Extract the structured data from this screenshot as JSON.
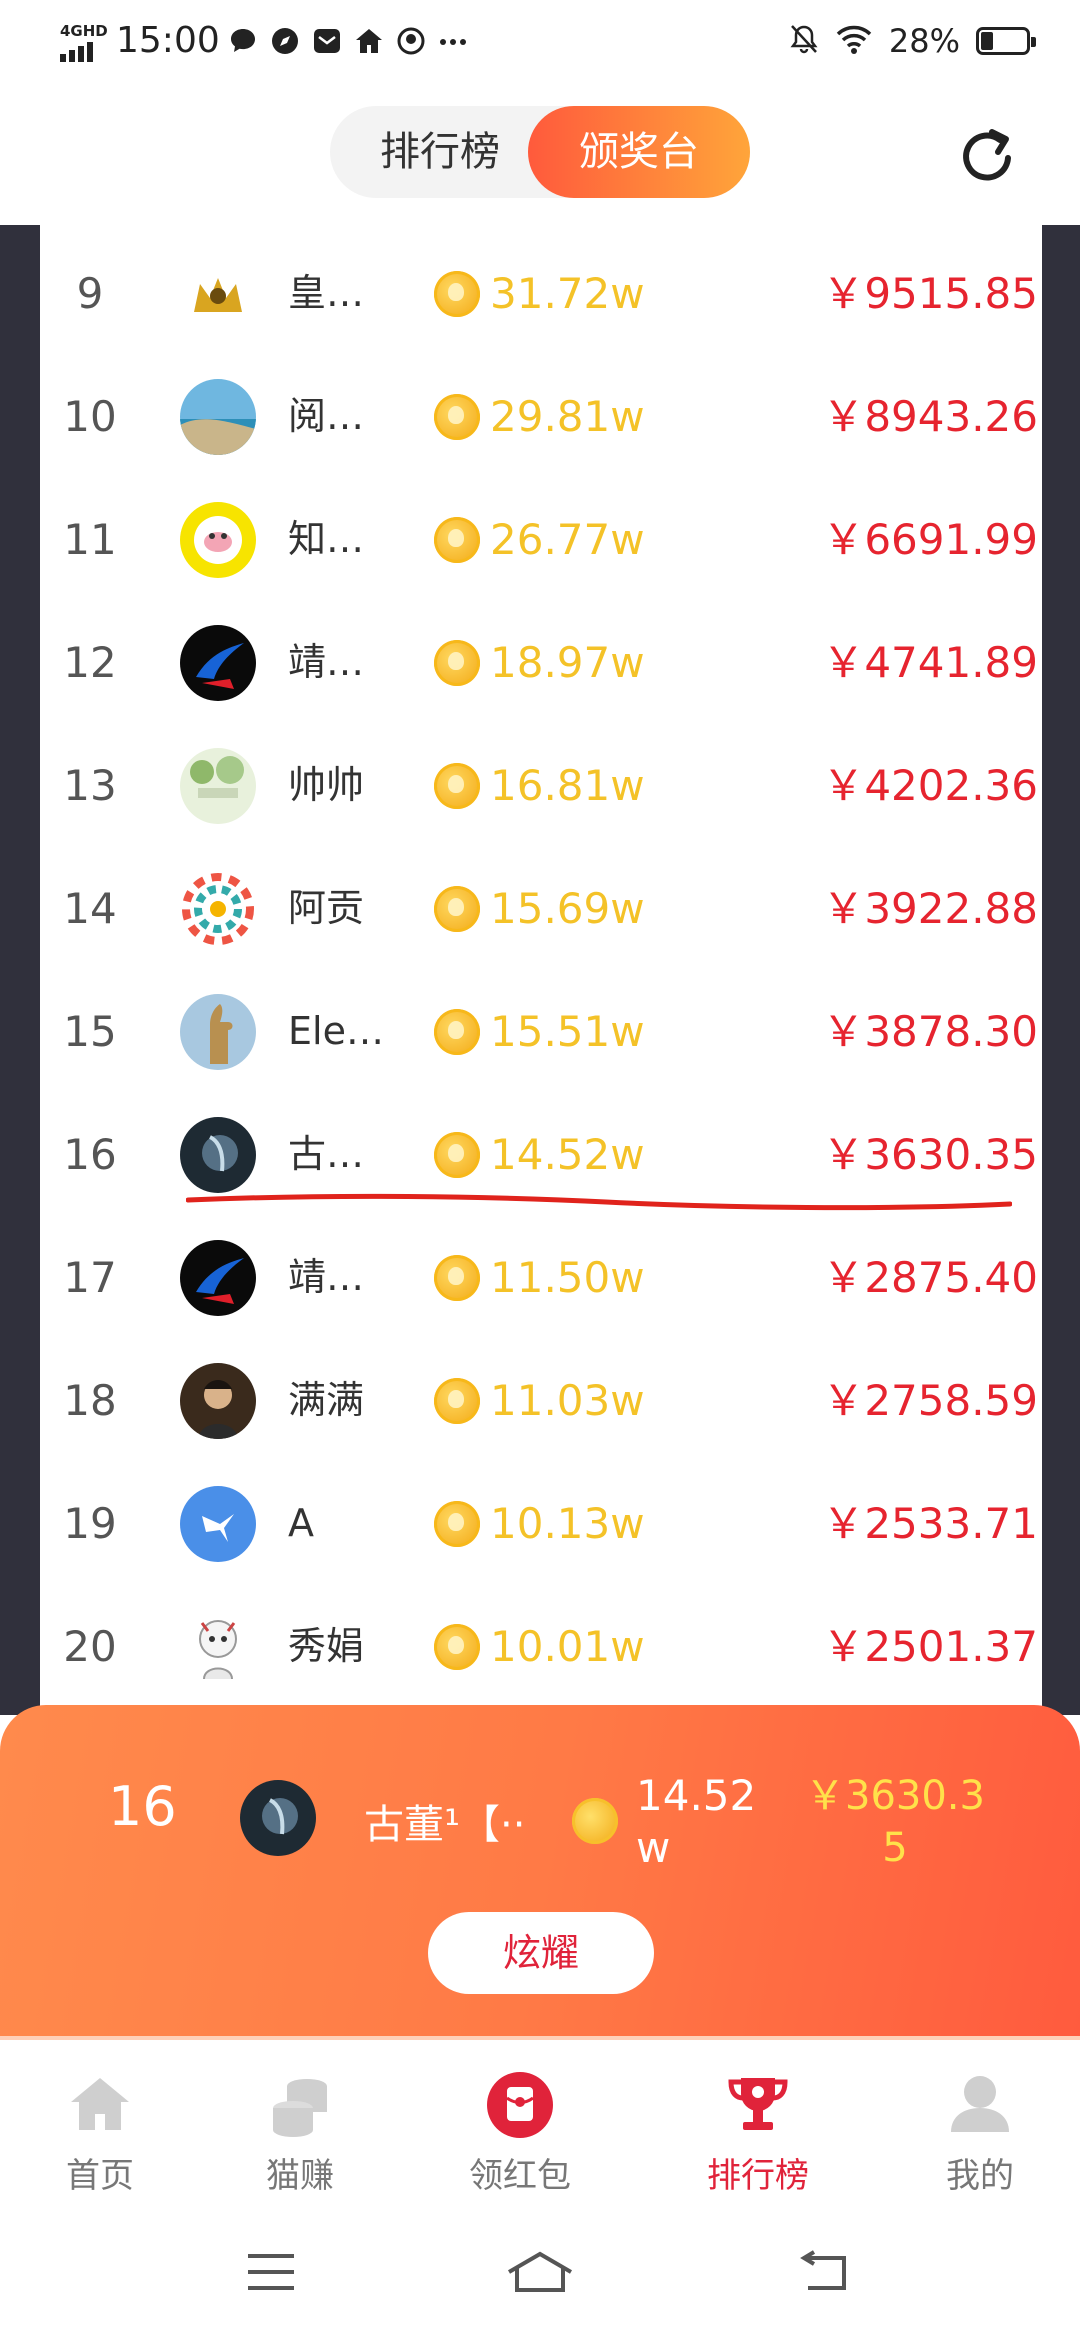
{
  "status_bar": {
    "network": "4GHD",
    "time": "15:00",
    "battery_percent": "28%",
    "battery_level": 0.28
  },
  "header": {
    "tabs": [
      {
        "label": "排行榜",
        "active": false
      },
      {
        "label": "颁奖台",
        "active": true
      }
    ]
  },
  "leaderboard": [
    {
      "rank": "9",
      "name": "皇…",
      "coins": "31.72w",
      "money": "￥9515.85"
    },
    {
      "rank": "10",
      "name": "阅…",
      "coins": "29.81w",
      "money": "￥8943.26"
    },
    {
      "rank": "11",
      "name": "知…",
      "coins": "26.77w",
      "money": "￥6691.99"
    },
    {
      "rank": "12",
      "name": "靖…",
      "coins": "18.97w",
      "money": "￥4741.89"
    },
    {
      "rank": "13",
      "name": "帅帅",
      "coins": "16.81w",
      "money": "￥4202.36"
    },
    {
      "rank": "14",
      "name": "阿贡",
      "coins": "15.69w",
      "money": "￥3922.88"
    },
    {
      "rank": "15",
      "name": "Ele…",
      "coins": "15.51w",
      "money": "￥3878.30"
    },
    {
      "rank": "16",
      "name": "古…",
      "coins": "14.52w",
      "money": "￥3630.35"
    },
    {
      "rank": "17",
      "name": "靖…",
      "coins": "11.50w",
      "money": "￥2875.40"
    },
    {
      "rank": "18",
      "name": "满满",
      "coins": "11.03w",
      "money": "￥2758.59"
    },
    {
      "rank": "19",
      "name": "A",
      "coins": "10.13w",
      "money": "￥2533.71"
    },
    {
      "rank": "20",
      "name": "秀娟",
      "coins": "10.01w",
      "money": "￥2501.37"
    }
  ],
  "my_rank": {
    "rank": "16",
    "name": "古董¹【··",
    "coins": "14.52w",
    "money": "￥3630.35",
    "button_label": "炫耀"
  },
  "bottom_nav": [
    {
      "label": "首页",
      "icon": "home-icon",
      "active": false
    },
    {
      "label": "猫赚",
      "icon": "coin-stack-icon",
      "active": false
    },
    {
      "label": "领红包",
      "icon": "red-envelope-icon",
      "active": false
    },
    {
      "label": "排行榜",
      "icon": "trophy-icon",
      "active": true
    },
    {
      "label": "我的",
      "icon": "user-icon",
      "active": false
    }
  ],
  "colors": {
    "accent_red": "#e6242f",
    "coin_yellow": "#f4c228",
    "panel_orange": "#ff7a46"
  }
}
